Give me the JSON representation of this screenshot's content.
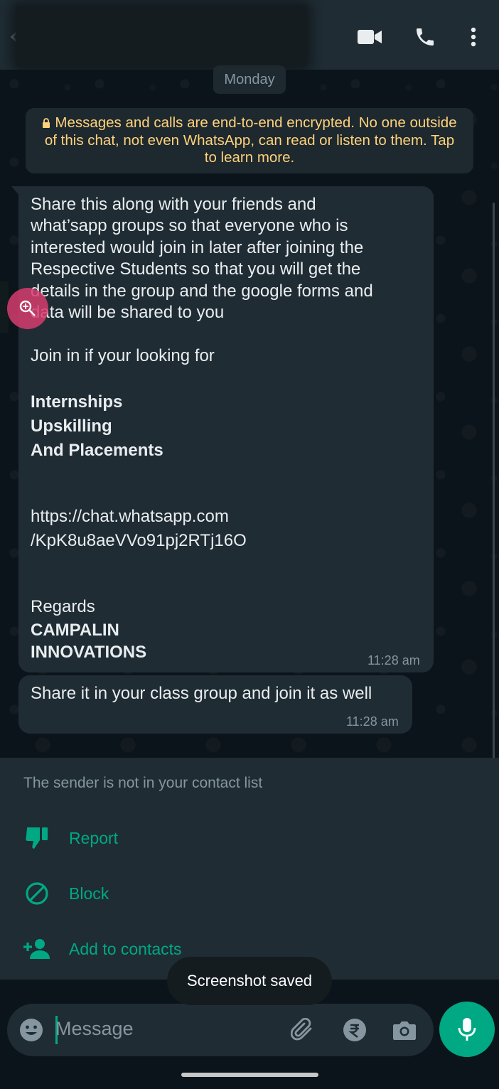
{
  "header": {
    "contact_name": "",
    "icons": [
      "back-arrow-icon",
      "video-call-icon",
      "voice-call-icon",
      "more-options-icon"
    ]
  },
  "chat": {
    "date_chip": "Monday",
    "encryption_notice": {
      "lines": [
        "Messages and calls are end-to-end encrypted. No one outside",
        "of this chat, not even WhatsApp, can read or listen to them. Tap",
        "to learn more."
      ],
      "color": "#ffd279"
    },
    "messages": [
      {
        "lines": [
          "Share this along with your friends and",
          "what’sapp groups so that everyone who is",
          "interested would join in later after joining the",
          "Respective Students so that you will get the",
          "details in the group and the google forms and",
          "data will be shared to you",
          "Join in if your looking for",
          "Internships",
          "Upskilling",
          "And Placements",
          "https://chat.whatsapp.com",
          "/KpK8u8aeVVo91pj2RTj16O",
          "Regards",
          "CAMPALIN",
          "INNOVATIONS"
        ],
        "time": "11:28 am"
      },
      {
        "lines": [
          "Share it in your class group and join it as well"
        ],
        "time": "11:28 am"
      }
    ]
  },
  "unknown_sender": {
    "note": "The sender is not in your contact list",
    "actions": [
      {
        "label": "Report",
        "icon": "thumbs-down-icon"
      },
      {
        "label": "Block",
        "icon": "block-icon"
      },
      {
        "label": "Add to contacts",
        "icon": "add-person-icon"
      }
    ],
    "accent": "#00a884"
  },
  "composer": {
    "placeholder": "Message",
    "icons": [
      "emoji-icon",
      "attach-icon",
      "rupee-payment-icon",
      "camera-icon",
      "mic-icon"
    ]
  },
  "toast": "Screenshot saved",
  "colors": {
    "background": "#0b141a",
    "bubble": "#1f2c34",
    "text": "#e9edef",
    "muted": "#8696a0"
  }
}
